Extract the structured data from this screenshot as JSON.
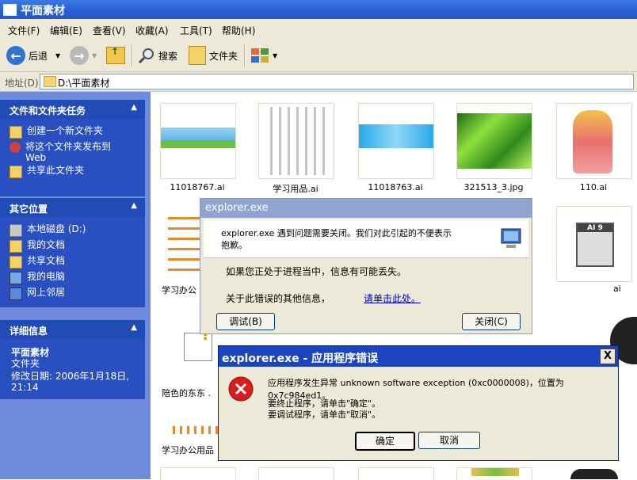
{
  "window": {
    "title": "平面素材"
  },
  "menu": [
    "文件(F)",
    "编辑(E)",
    "查看(V)",
    "收藏(A)",
    "工具(T)",
    "帮助(H)"
  ],
  "toolbar": {
    "back": "后退",
    "search": "搜索",
    "folders": "文件夹"
  },
  "address": {
    "label": "地址(D)",
    "path": "D:\\平面素材"
  },
  "left": {
    "tasks": {
      "title": "文件和文件夹任务",
      "items": [
        "创建一个新文件夹",
        "将这个文件夹发布到\nWeb",
        "共享此文件夹"
      ]
    },
    "places": {
      "title": "其它位置",
      "items": [
        "本地磁盘 (D:)",
        "我的文档",
        "共享文档",
        "我的电脑",
        "网上邻居"
      ]
    },
    "details": {
      "title": "详细信息",
      "name": "平面素材",
      "type": "文件夹",
      "modified": "修改日期: 2006年1月18日,\n21:14"
    }
  },
  "files": [
    {
      "name": "11018767.ai"
    },
    {
      "name": "学习用品.ai"
    },
    {
      "name": "11018763.ai"
    },
    {
      "name": "321513_3.jpg"
    },
    {
      "name": "110.ai"
    },
    {
      "name": "学习办公"
    },
    {
      "name": "ai"
    },
    {
      "name": "陪色的东东 ."
    },
    {
      "name": "学习办公用品"
    }
  ],
  "thumb_badge": "AI 9",
  "dialog1": {
    "title": "explorer.exe",
    "message": "explorer.exe 遇到问题需要关闭。我们对此引起的不便表示\n抱歉。",
    "info": "如果您正处于进程当中，信息有可能丢失。",
    "more_label": "关于此错误的其他信息，",
    "more_link": "请单击此处。",
    "debug_btn": "调试(B)",
    "close_btn": "关闭(C)"
  },
  "dialog2": {
    "title": "explorer.exe - 应用程序错误",
    "message": "应用程序发生异常 unknown software exception (0xc0000008)，位置为 0x7c984ed1。",
    "line2": "要终止程序，请单击\"确定\"。",
    "line3": "要调试程序，请单击\"取消\"。",
    "ok": "确定",
    "cancel": "取消",
    "close_x": "X"
  },
  "colors": {
    "xp_blue": "#2a5fd2",
    "panel_blue": "#2a4fc0",
    "error_red": "#d81e1e"
  }
}
